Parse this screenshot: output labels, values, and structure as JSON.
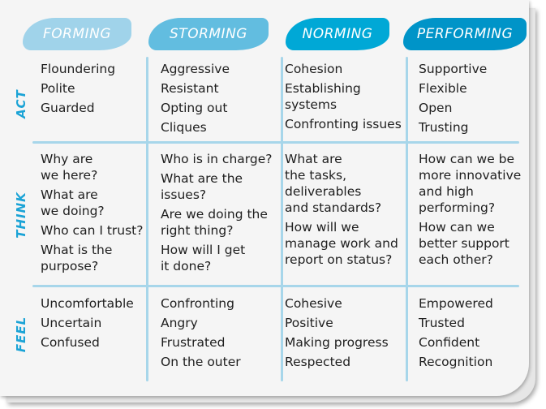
{
  "stages": [
    {
      "label": "FORMING",
      "color": "#a0d3ea"
    },
    {
      "label": "STORMING",
      "color": "#62bde0"
    },
    {
      "label": "NORMING",
      "color": "#00a8d6"
    },
    {
      "label": "PERFORMING",
      "color": "#0094c8"
    }
  ],
  "rows": [
    "ACT",
    "THINK",
    "FEEL"
  ],
  "cells": {
    "act": [
      [
        "Floundering",
        "Polite",
        "Guarded"
      ],
      [
        "Aggressive",
        "Resistant",
        "Opting out",
        "Cliques"
      ],
      [
        "Cohesion",
        "Establishing\nsystems",
        "Confronting issues"
      ],
      [
        "Supportive",
        "Flexible",
        "Open",
        "Trusting"
      ]
    ],
    "think": [
      [
        "Why are\nwe here?",
        "What are\nwe doing?",
        "Who can I trust?",
        "What is the\npurpose?"
      ],
      [
        "Who is in charge?",
        "What are the\nissues?",
        "Are we doing the\nright thing?",
        "How will I get\nit done?"
      ],
      [
        "What are\nthe tasks,\ndeliverables\nand standards?",
        "How will we\nmanage work and\nreport on status?"
      ],
      [
        "How can we be\nmore innovative\nand high\nperforming?",
        "How can we\nbetter support\neach other?"
      ]
    ],
    "feel": [
      [
        "Uncomfortable",
        "Uncertain",
        "Confused"
      ],
      [
        "Confronting",
        "Angry",
        "Frustrated",
        "On the outer"
      ],
      [
        "Cohesive",
        "Positive",
        "Making progress",
        "Respected"
      ],
      [
        "Empowered",
        "Trusted",
        "Confident",
        "Recognition"
      ]
    ]
  },
  "line_color": "#a7d6ea",
  "row_label_color": "#1aa3d6"
}
